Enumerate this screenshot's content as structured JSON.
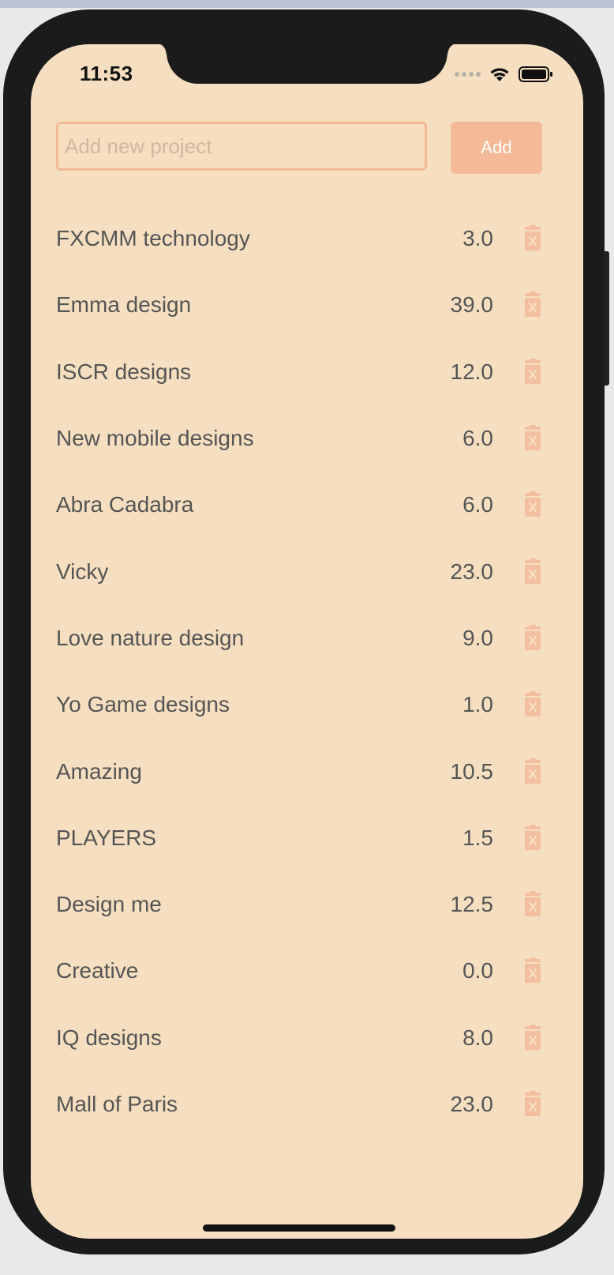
{
  "status_bar": {
    "time": "11:53"
  },
  "new_project": {
    "placeholder": "Add new project",
    "value": "",
    "add_label": "Add"
  },
  "projects": [
    {
      "name": "FXCMM technology",
      "hours": "3.0"
    },
    {
      "name": "Emma design",
      "hours": "39.0"
    },
    {
      "name": "ISCR designs",
      "hours": "12.0"
    },
    {
      "name": "New mobile designs",
      "hours": "6.0"
    },
    {
      "name": "Abra Cadabra",
      "hours": "6.0"
    },
    {
      "name": "Vicky",
      "hours": "23.0"
    },
    {
      "name": "Love nature design",
      "hours": "9.0"
    },
    {
      "name": "Yo Game designs",
      "hours": "1.0"
    },
    {
      "name": "Amazing",
      "hours": "10.5"
    },
    {
      "name": "PLAYERS",
      "hours": "1.5"
    },
    {
      "name": "Design me",
      "hours": "12.5"
    },
    {
      "name": "Creative",
      "hours": "0.0"
    },
    {
      "name": "IQ designs",
      "hours": "8.0"
    },
    {
      "name": "Mall of Paris",
      "hours": "23.0"
    }
  ],
  "icons": {
    "delete": "trash-x-icon",
    "wifi": "wifi-icon",
    "battery": "battery-icon",
    "signal": "cellular-signal-icon"
  },
  "colors": {
    "background": "#f6dfc0",
    "accent": "#f4b997",
    "text": "#555555"
  }
}
